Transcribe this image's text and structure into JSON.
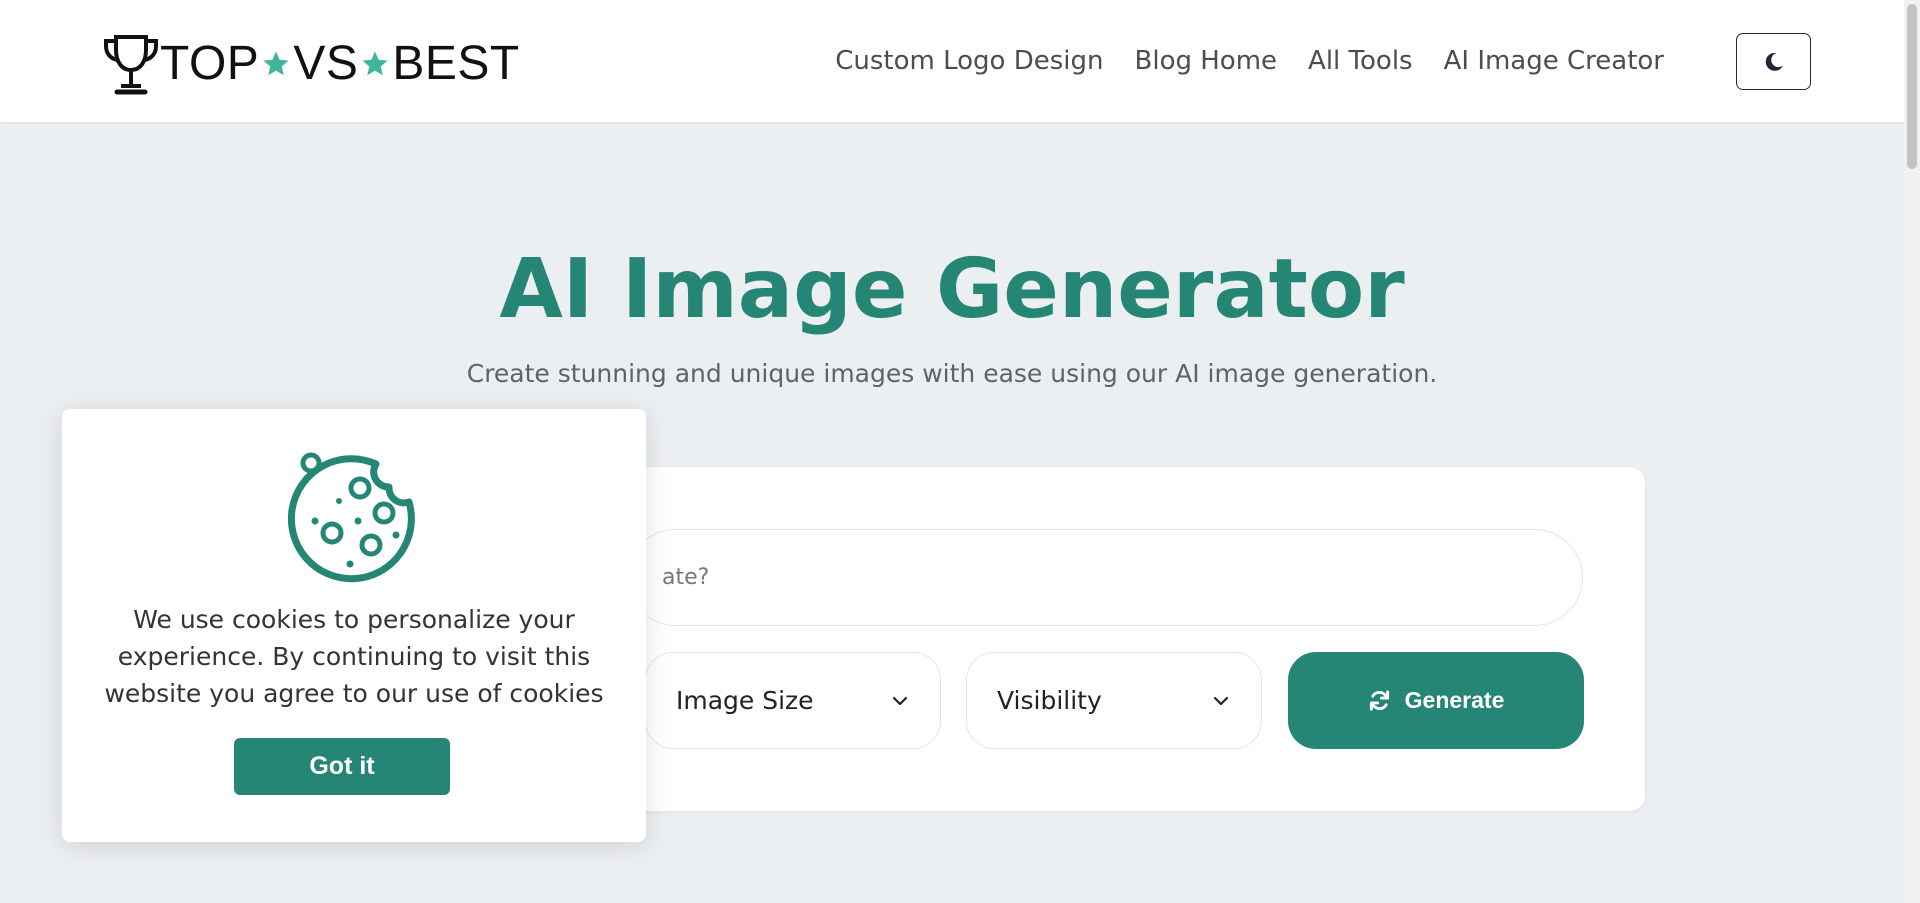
{
  "brand": {
    "logo_words": [
      "TOP",
      "VS",
      "BEST"
    ],
    "accent_color": "#268675",
    "star_color": "#3fb59d"
  },
  "nav": {
    "items": [
      {
        "label": "Custom Logo Design"
      },
      {
        "label": "Blog Home"
      },
      {
        "label": "All Tools"
      },
      {
        "label": "AI Image Creator"
      }
    ],
    "theme_toggle_icon": "moon-icon"
  },
  "hero": {
    "title": "AI Image Generator",
    "subtitle": "Create stunning and unique images with ease using our AI image generation."
  },
  "generator": {
    "prompt_visible_placeholder": "ate?",
    "size_select": {
      "label": "Image Size",
      "icon": "chevron-down-icon"
    },
    "visibility_select": {
      "label": "Visibility",
      "icon": "chevron-down-icon"
    },
    "generate_button": {
      "label": "Generate",
      "icon": "refresh-icon"
    }
  },
  "cookie_banner": {
    "icon": "cookie-icon",
    "message": "We use cookies to personalize your experience. By continuing to visit this website you agree to our use of cookies",
    "button_label": "Got it"
  }
}
